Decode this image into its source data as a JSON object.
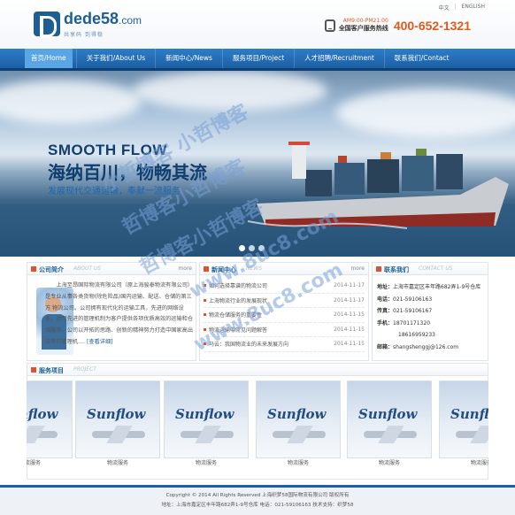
{
  "header": {
    "logo_main": "dede58",
    "logo_dot": ".com",
    "logo_sub": "共享码 到得稳",
    "lang": [
      "中文",
      "ENGLISH"
    ],
    "hours": "AM9:00-PM21:00",
    "hotline_label": "全国客户服务热线",
    "hotline_number": "400-652-1321"
  },
  "nav": {
    "items": [
      {
        "label": "首页/Home"
      },
      {
        "label": "关于我们/About Us"
      },
      {
        "label": "新闻中心/News"
      },
      {
        "label": "服务项目/Project"
      },
      {
        "label": "人才招聘/Recruitment"
      },
      {
        "label": "联系我们/Contact"
      }
    ]
  },
  "banner": {
    "title_en": "SMOOTH FLOW",
    "title_cn": "海纳百川，物畅其流",
    "subtitle": "发展现代交通运输，奉献一流服务"
  },
  "about": {
    "title": "公司简介",
    "subtitle": "ABOUT US",
    "more": "more",
    "text": "上海至昂国际物流有限公司（原上海骏泰物流有限公司）是专业从事各类货物(除危险品)国内运输、配送、仓储的第三方 物流公司。公司拥有现代化的运输工具，先进的网络设备，运用先进的管理机制为客户提供各项优质高效的运输和仓储服务。公司以开拓的思路、创新的精神努力打造中国家高出效率的管理机....",
    "read_more": "[查看详细]"
  },
  "news": {
    "title": "新闻中心",
    "subtitle": "NEWS",
    "more": "more",
    "items": [
      {
        "title": "如何选择靠谱的物流公司",
        "date": "2014-11-17"
      },
      {
        "title": "上海物流行业的发展现状",
        "date": "2014-11-17"
      },
      {
        "title": "物流仓储服务的重要性",
        "date": "2014-11-15"
      },
      {
        "title": "物流运输中常见问题解答",
        "date": "2014-11-15"
      },
      {
        "title": "马云：我国物流业的未来发展方向",
        "date": "2014-11-15"
      }
    ]
  },
  "contact": {
    "title": "联系我们",
    "subtitle": "CONTACT US",
    "more": "more",
    "rows": [
      {
        "label": "地址：",
        "value": "上海市嘉定区丰年路682弄1-9号仓库"
      },
      {
        "label": "电话：",
        "value": "021-59106163"
      },
      {
        "label": "传真：",
        "value": "021-59106167"
      },
      {
        "label": "手机：",
        "value": "18701171320"
      },
      {
        "label": "",
        "value": "18616959233"
      },
      {
        "label": "邮箱：",
        "value": "shangshenggj@126.com"
      }
    ]
  },
  "services": {
    "title": "服务项目",
    "subtitle": "PROJECT",
    "logo_text": "Sunflow",
    "items": [
      {
        "caption": "物流服务"
      },
      {
        "caption": "物流服务"
      },
      {
        "caption": "物流服务"
      },
      {
        "caption": "物流服务"
      },
      {
        "caption": "物流服务"
      },
      {
        "caption": "物流服务"
      }
    ]
  },
  "footer": {
    "line1": "Copyright © 2014 All Rights Reserved 上海织梦58国际物流有限公司 版权所有",
    "line2": "地址：上海市嘉定区丰年路682弄1-9号仓库 电话：021-59106163 技术支持：织梦58"
  },
  "watermark": [
    "小哲博客 小哲博客",
    "哲博客小哲博客",
    "www.8uc8.com",
    "www.8uc8.com",
    "哲博客小哲博客"
  ],
  "colors": {
    "brand": "#1d5f93",
    "accent": "#e05a1a",
    "nav": "#2e7dc8",
    "nav_active": "#5aa6e4"
  }
}
